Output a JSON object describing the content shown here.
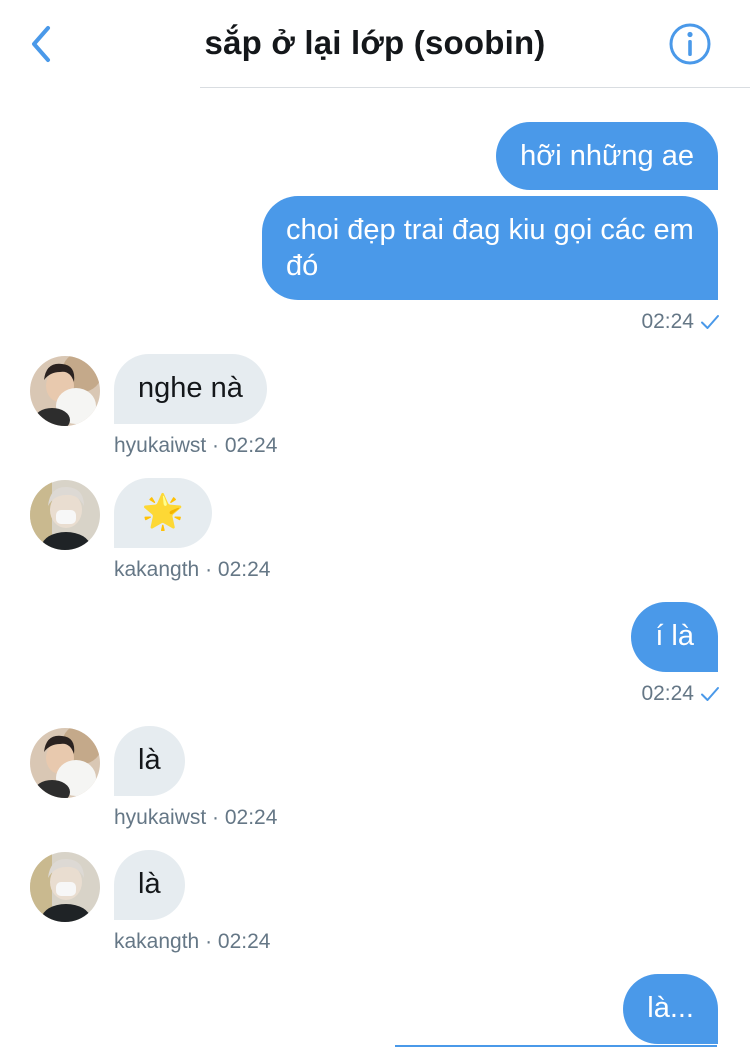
{
  "header": {
    "title": "sắp ở lại lớp (soobin)"
  },
  "messages": [
    {
      "type": "out",
      "text": "hỡi những ae"
    },
    {
      "type": "out",
      "text": "choi đẹp trai đag kiu gọi các em đó",
      "line1": "choi đẹp trai đag kiu gọi các",
      "line2": "em đó",
      "time": "02:24"
    },
    {
      "type": "in",
      "text": "nghe nà",
      "meta": "hyukaiwst · 02:24"
    },
    {
      "type": "in",
      "text": "🌟",
      "meta": "kakangth · 02:24"
    },
    {
      "type": "out",
      "text": "í là",
      "time": "02:24"
    },
    {
      "type": "in",
      "text": "là",
      "meta": "hyukaiwst · 02:24"
    },
    {
      "type": "in",
      "text": "là",
      "meta": "kakangth · 02:24"
    },
    {
      "type": "out",
      "text": "là..."
    }
  ],
  "colors": {
    "accent": "#4a99e9",
    "incoming_bubble": "#e6ecf0",
    "meta_text": "#657786"
  },
  "icons": {
    "back": "chevron-left-icon",
    "info": "info-circle-icon",
    "read": "checkmark-icon"
  }
}
